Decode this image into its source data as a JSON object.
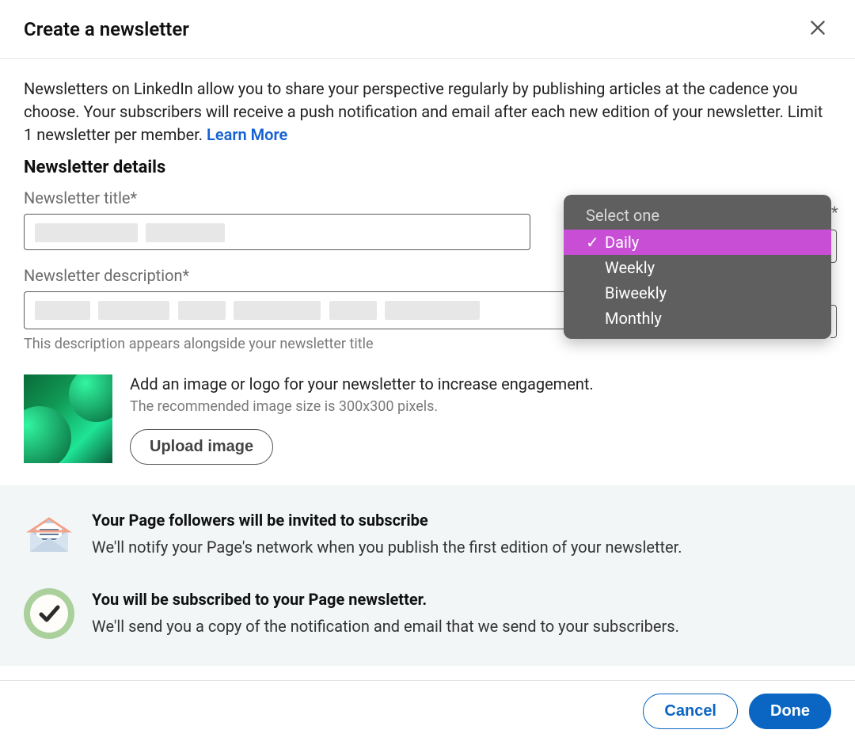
{
  "header": {
    "title": "Create a newsletter"
  },
  "intro": {
    "text": "Newsletters on LinkedIn allow you to share your perspective regularly by publishing articles at the cadence you choose. Your subscribers will receive a push notification and email after each new edition of your newsletter. Limit 1 newsletter per member. ",
    "learn_more": "Learn More"
  },
  "section_title": "Newsletter details",
  "fields": {
    "title_label": "Newsletter title*",
    "desc_label": "Newsletter description*",
    "desc_helper": "This description appears alongside your newsletter title",
    "asterisk": "*"
  },
  "dropdown": {
    "header": "Select one",
    "options": [
      "Daily",
      "Weekly",
      "Biweekly",
      "Monthly"
    ],
    "selected_index": 0
  },
  "image_section": {
    "lead": "Add an image or logo for your newsletter to increase engagement.",
    "sub": "The recommended image size is 300x300 pixels.",
    "upload_label": "Upload image"
  },
  "info": {
    "item1": {
      "title": "Your Page followers will be invited to subscribe",
      "body": "We'll notify your Page's network when you publish the first edition of your newsletter."
    },
    "item2": {
      "title": "You will be subscribed to your Page newsletter.",
      "body": "We'll send you a copy of the notification and email that we send to your subscribers."
    }
  },
  "footer": {
    "cancel": "Cancel",
    "done": "Done"
  },
  "icons": {
    "close": "close-icon",
    "envelope": "envelope-icon",
    "check_circle": "check-circle-icon",
    "checkmark": "✓"
  }
}
